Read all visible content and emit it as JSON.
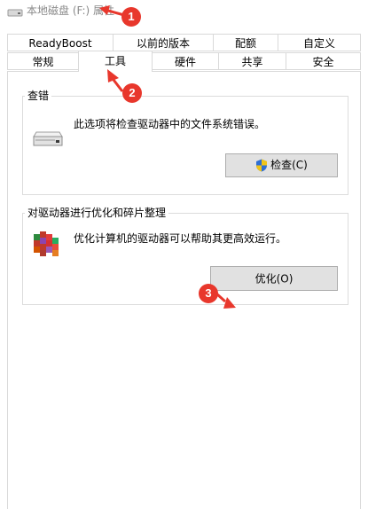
{
  "window": {
    "title": "本地磁盘 (F:) 属性"
  },
  "tabs_row1": [
    "ReadyBoost",
    "以前的版本",
    "配额",
    "自定义"
  ],
  "tabs_row2": [
    "常规",
    "工具",
    "硬件",
    "共享",
    "安全"
  ],
  "active_tab": "工具",
  "error_check": {
    "title": "查错",
    "description": "此选项将检查驱动器中的文件系统错误。",
    "button_label": "检查(C)"
  },
  "optimize": {
    "title": "对驱动器进行优化和碎片整理",
    "description": "优化计算机的驱动器可以帮助其更高效运行。",
    "button_label": "优化(O)"
  },
  "annotations": [
    "1",
    "2",
    "3"
  ],
  "colors": {
    "annotation": "#e8372c",
    "button_bg": "#e1e1e1",
    "border": "#d9d9d9"
  }
}
